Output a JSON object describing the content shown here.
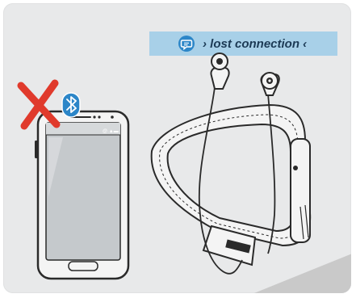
{
  "status_banner": {
    "text": "› lost connection ‹",
    "icon": "chat-bubble-icon",
    "background": "#a8d0e8",
    "icon_color": "#2c86c8"
  },
  "phone": {
    "bluetooth_icon": "bluetooth-icon",
    "disconnected_marker": "red-x-icon",
    "marker_color": "#e03a2c",
    "bluetooth_color": "#2c86c8"
  },
  "headset": {
    "brand_strip": "SENNHEISER"
  }
}
